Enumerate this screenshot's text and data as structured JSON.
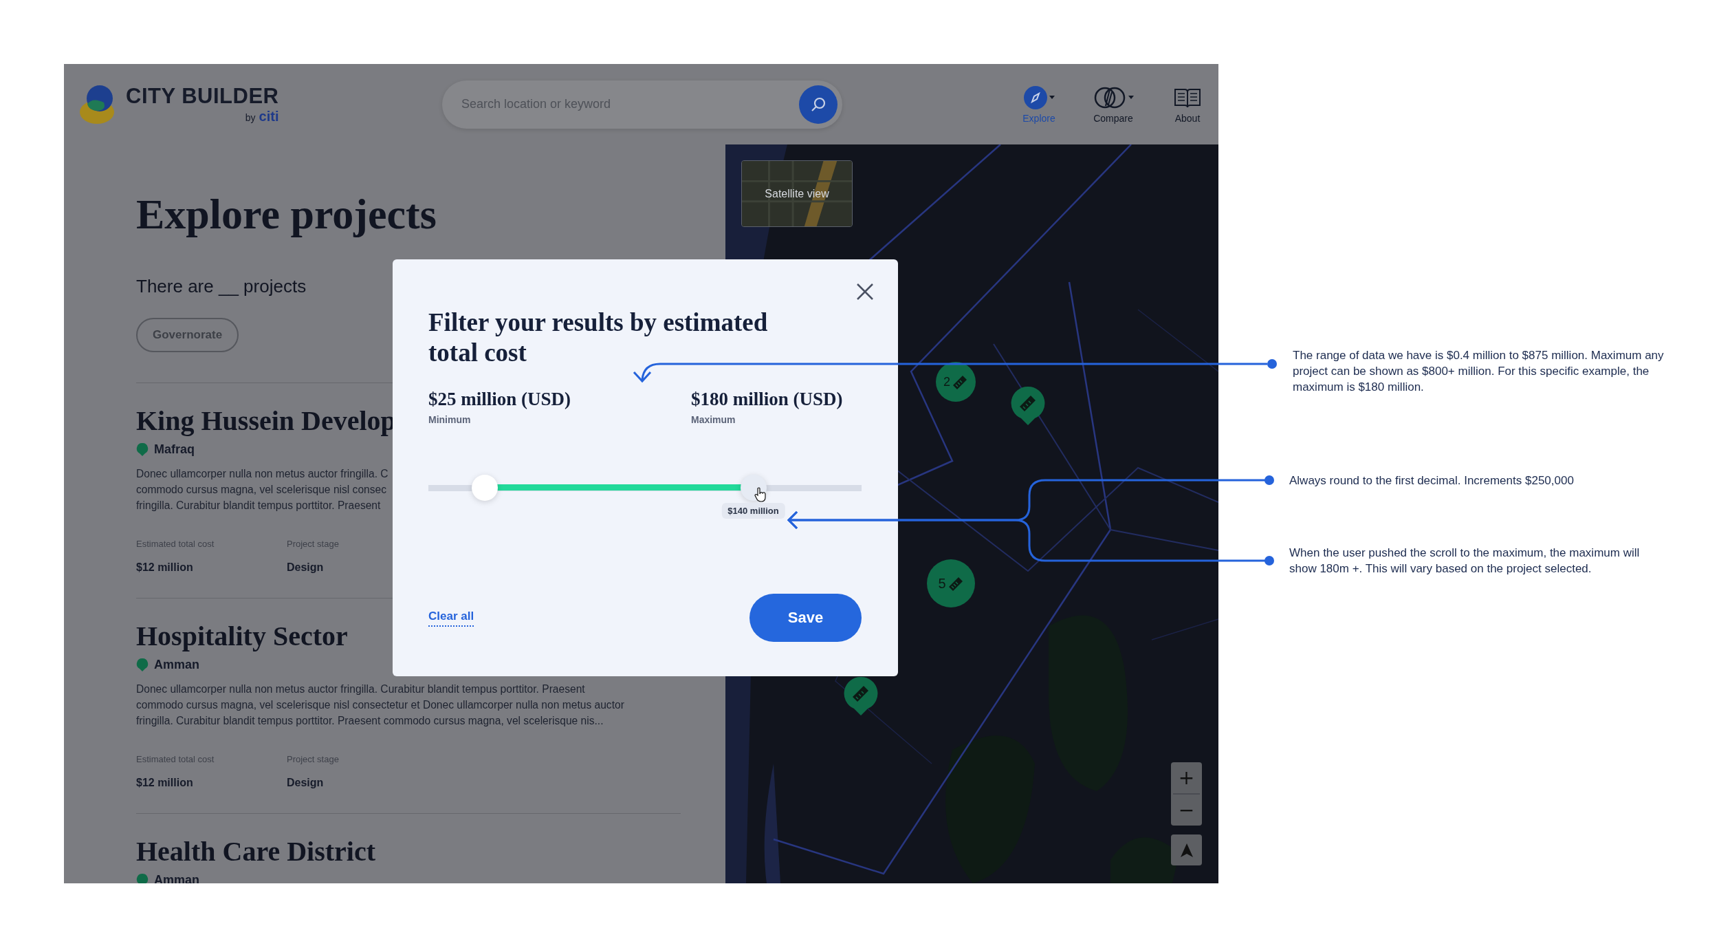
{
  "header": {
    "logo": {
      "name": "CITY BUILDER",
      "by": "by",
      "brand": "citi"
    },
    "search": {
      "placeholder": "Search location or keyword"
    },
    "nav": [
      {
        "label": "Explore",
        "selected": true,
        "kind": "compass"
      },
      {
        "label": "Compare",
        "selected": false,
        "kind": "compare"
      },
      {
        "label": "About",
        "selected": false,
        "kind": "book"
      }
    ]
  },
  "page": {
    "title": "Explore projects",
    "count_text": "There are __ projects",
    "filters": [
      {
        "label": "Governorate"
      }
    ]
  },
  "projects": [
    {
      "title": "King Hussein Develop",
      "location": "Mafraq",
      "description": "Donec ullamcorper nulla non metus auctor fringilla. C\ncommodo cursus magna, vel scelerisque nisl consec\nfringilla. Curabitur blandit tempus porttitor. Praesent",
      "meta": [
        {
          "label": "Estimated total cost",
          "value": "$12 million"
        },
        {
          "label": "Project stage",
          "value": "Design"
        }
      ]
    },
    {
      "title": "Hospitality Sector",
      "location": "Amman",
      "description": "Donec ullamcorper nulla non metus auctor fringilla. Curabitur blandit tempus porttitor. Praesent\ncommodo cursus magna, vel scelerisque nisl consectetur et Donec ullamcorper nulla non metus auctor\nfringilla. Curabitur blandit tempus porttitor. Praesent commodo cursus magna, vel scelerisque nis...",
      "meta": [
        {
          "label": "Estimated total cost",
          "value": "$12 million"
        },
        {
          "label": "Project stage",
          "value": "Design"
        }
      ]
    },
    {
      "title": "Health Care District",
      "location": "Amman"
    }
  ],
  "map": {
    "satellite_label": "Satellite view",
    "markers": [
      {
        "kind": "cluster",
        "count": "2"
      },
      {
        "kind": "pin"
      },
      {
        "kind": "cluster",
        "count": "5"
      },
      {
        "kind": "pin"
      }
    ],
    "zoom_in": "+",
    "zoom_out": "−"
  },
  "modal": {
    "title": "Filter your results by estimated total cost",
    "minimum": {
      "value": "$25 million (USD)",
      "label": "Minimum"
    },
    "maximum": {
      "value": "$180 million (USD)",
      "label": "Maximum"
    },
    "slider": {
      "thumbs": [
        {
          "level": 0.13
        },
        {
          "level": 0.75
        }
      ],
      "tooltip": "$140 million"
    },
    "clear": "Clear all",
    "save": "Save"
  },
  "annotations": [
    {
      "text": "The range of data we have is $0.4 million to $875 million. Maximum any project can be shown as $800+ million. For this specific example, the maximum is $180 million."
    },
    {
      "text": "Always round to the first decimal. Increments $250,000"
    },
    {
      "text": "When the user pushed the scroll to the maximum, the maximum will show 180m +. This will vary based on the project selected."
    }
  ]
}
